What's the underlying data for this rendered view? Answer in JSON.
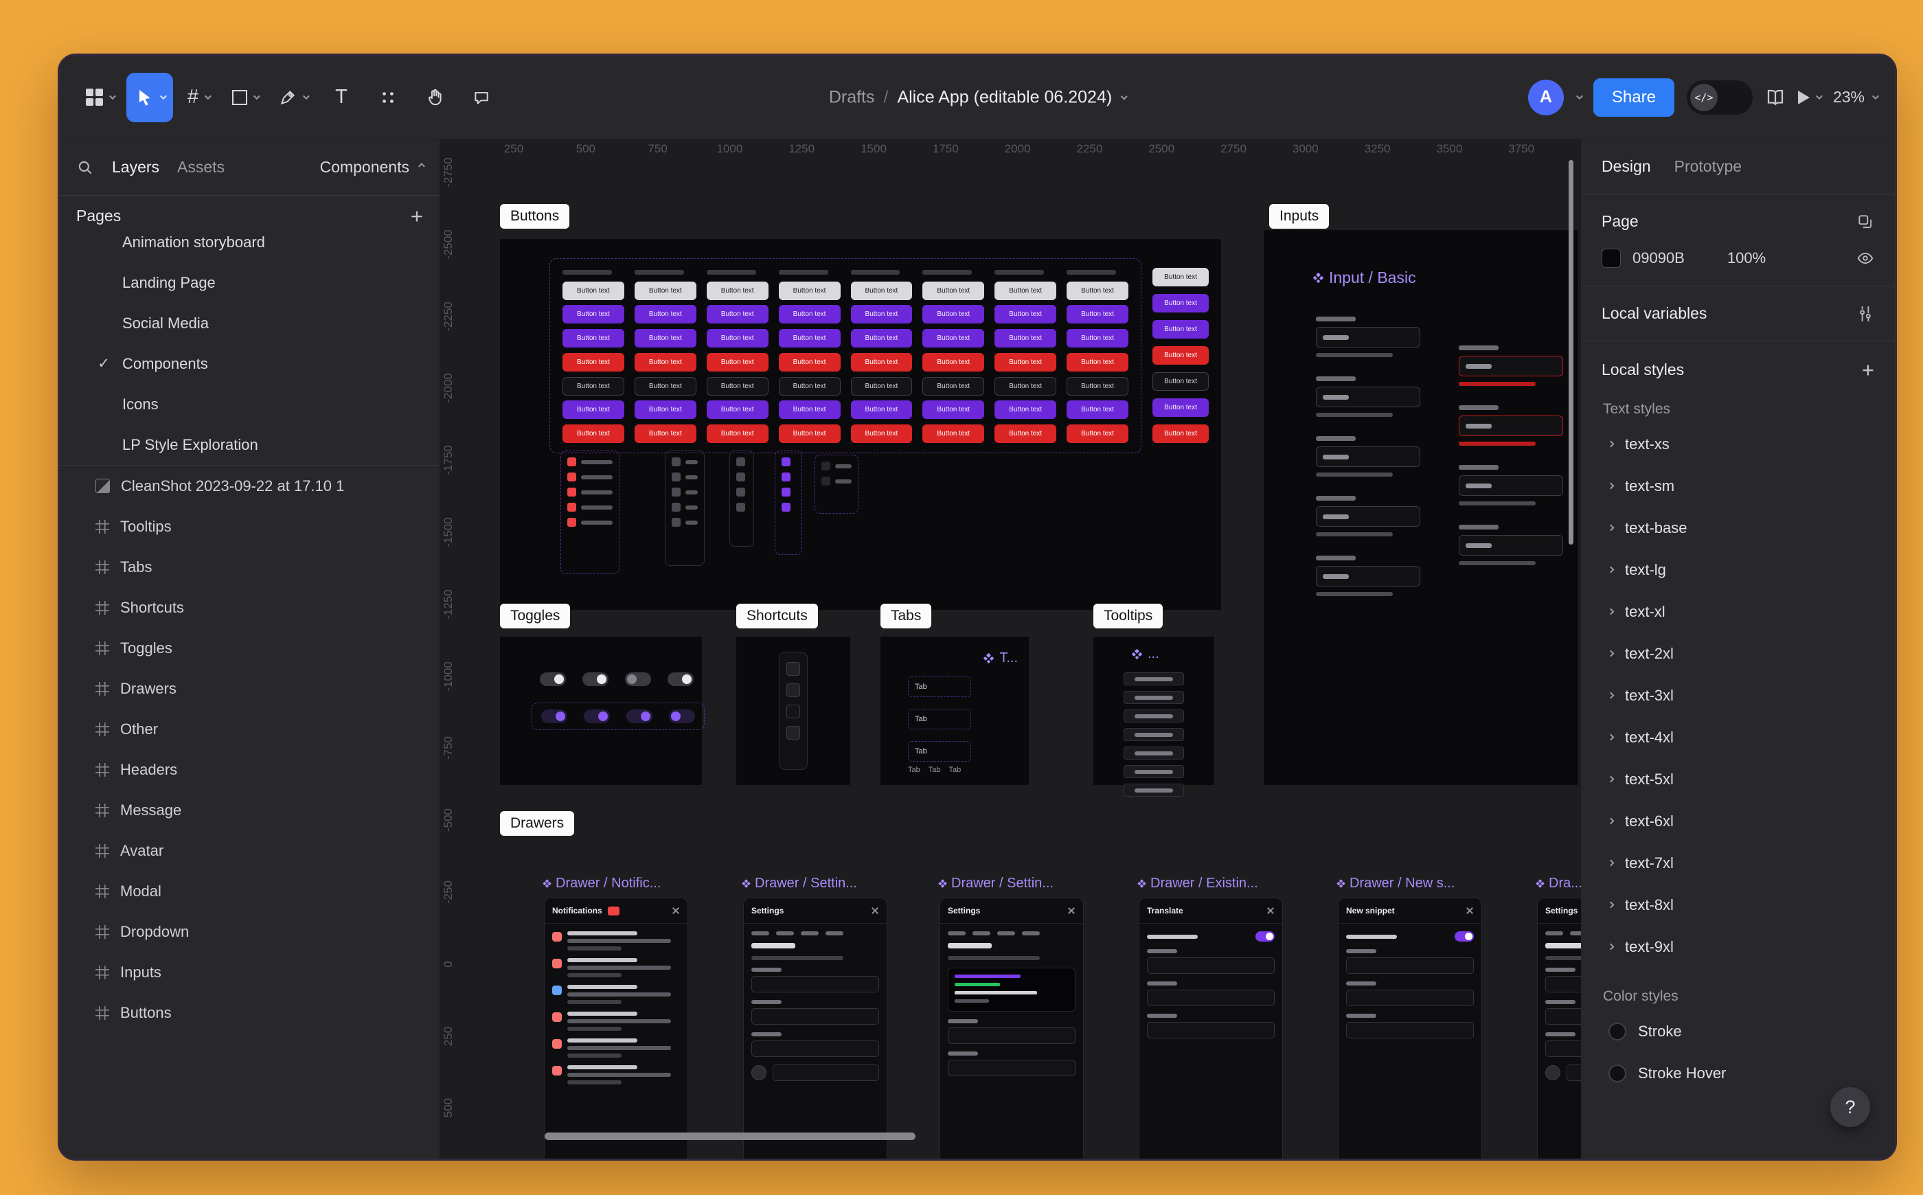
{
  "icons": {
    "plus": "+",
    "frame_tool": "#",
    "text_tool": "T",
    "code": "</>"
  },
  "help_label": "?",
  "toolbar": {
    "breadcrumb": {
      "folder": "Drafts",
      "separator": "/",
      "file": "Alice App (editable 06.2024)"
    },
    "avatar_initial": "A",
    "share_label": "Share",
    "zoom_label": "23%"
  },
  "left_sidebar": {
    "tabs": {
      "layers": "Layers",
      "assets": "Assets"
    },
    "current_page": "Components",
    "pages_header": "Pages",
    "pages": [
      {
        "check": "",
        "name": "Animation storyboard"
      },
      {
        "check": "",
        "name": "Landing Page"
      },
      {
        "check": "",
        "name": "Social Media"
      },
      {
        "check": "✓",
        "name": "Components"
      },
      {
        "check": "",
        "name": "Icons"
      },
      {
        "check": "",
        "name": "LP Style Exploration"
      }
    ],
    "image_layer": "CleanShot 2023-09-22 at 17.10 1",
    "frame_layers": [
      "Tooltips",
      "Tabs",
      "Shortcuts",
      "Toggles",
      "Drawers",
      "Other",
      "Headers",
      "Message",
      "Avatar",
      "Modal",
      "Dropdown",
      "Inputs",
      "Buttons"
    ]
  },
  "canvas": {
    "h_ruler": [
      "250",
      "500",
      "750",
      "1000",
      "1250",
      "1500",
      "1750",
      "2000",
      "2250",
      "2500",
      "2750",
      "3000",
      "3250",
      "3500",
      "3750"
    ],
    "v_ruler": [
      "-2750",
      "-2500",
      "-2250",
      "-2000",
      "-1750",
      "-1500",
      "-1250",
      "-1000",
      "-750",
      "-500",
      "-250",
      "0",
      "250",
      "500"
    ],
    "chips": {
      "buttons": "Buttons",
      "inputs": "Inputs",
      "toggles": "Toggles",
      "shortcuts": "Shortcuts",
      "tabs": "Tabs",
      "tooltips": "Tooltips",
      "drawers": "Drawers"
    },
    "buttons_sheet": {
      "button_label": "Button text",
      "cols": 8,
      "rows": [
        "light",
        "purple",
        "purple",
        "red",
        "outline",
        "purple",
        "red"
      ],
      "colors": {
        "light": {
          "bg": "#d9d9de",
          "fg": "#1a1a1e"
        },
        "purple": {
          "bg": "#6d28d9",
          "fg": "#f3efff"
        },
        "red": {
          "bg": "#dc2626",
          "fg": "#ffffff"
        },
        "outline": {
          "bg": "#141417",
          "fg": "#d6d6db",
          "border": "#3f3f46"
        }
      }
    },
    "inputs_frame": {
      "component_label": "Input / Basic",
      "left_states": [
        "default",
        "default",
        "default",
        "default",
        "default"
      ],
      "right_states": [
        "error",
        "error",
        "default",
        "default"
      ],
      "error_color": "#b91c1c"
    },
    "tabs_frame": {
      "component_label": "T...",
      "tab_label": "Tab"
    },
    "tooltips_frame": {
      "component_label": "...",
      "count": 7
    },
    "notification_colors": [
      "#f87171",
      "#f87171",
      "#60a5fa",
      "#f87171",
      "#f87171",
      "#f87171"
    ],
    "drawers": [
      {
        "label": "Drawer / Notific...",
        "title": "Notifications",
        "badge": true,
        "kind": "notifications"
      },
      {
        "label": "Drawer / Settin...",
        "title": "Settings",
        "kind": "settings"
      },
      {
        "label": "Drawer / Settin...",
        "title": "Settings",
        "kind": "settings-code"
      },
      {
        "label": "Drawer / Existin...",
        "title": "Translate",
        "toggle": true,
        "kind": "snippet"
      },
      {
        "label": "Drawer / New s...",
        "title": "New snippet",
        "toggle": true,
        "kind": "snippet"
      },
      {
        "label": "Dra...",
        "title": "Settings",
        "kind": "settings"
      }
    ]
  },
  "right_sidebar": {
    "tabs": {
      "design": "Design",
      "prototype": "Prototype"
    },
    "page_section": {
      "title": "Page",
      "color_hex": "09090B",
      "opacity": "100%"
    },
    "local_variables_label": "Local variables",
    "local_styles_label": "Local styles",
    "text_styles_header": "Text styles",
    "text_styles": [
      "text-xs",
      "text-sm",
      "text-base",
      "text-lg",
      "text-xl",
      "text-2xl",
      "text-3xl",
      "text-4xl",
      "text-5xl",
      "text-6xl",
      "text-7xl",
      "text-8xl",
      "text-9xl"
    ],
    "color_styles_header": "Color styles",
    "color_styles": [
      {
        "name": "Stroke"
      },
      {
        "name": "Stroke Hover"
      }
    ]
  }
}
